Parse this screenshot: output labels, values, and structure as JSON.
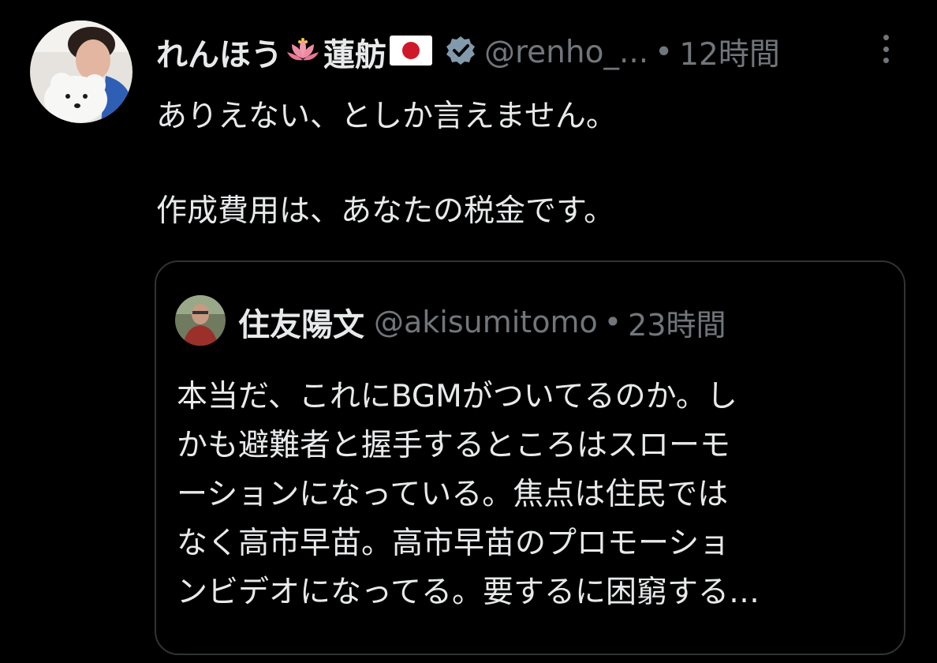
{
  "tweet": {
    "display_name_part1": "れんほう",
    "display_name_part2": "蓮舫",
    "handle": "@renho_...",
    "separator": "•",
    "time": "12時間",
    "text_line1": "ありえない、としか言えません。",
    "text_line2": "作成費用は、あなたの税金です。",
    "icons": [
      "avatar-photo",
      "lotus-emoji",
      "japan-flag-emoji",
      "verified-badge-icon",
      "more-options-icon"
    ]
  },
  "quote": {
    "display_name": "住友陽文",
    "handle": "@akisumitomo",
    "separator": "•",
    "time": "23時間",
    "lines": [
      "本当だ、これにBGMがついてるのか。し",
      "かも避難者と握手するところはスローモ",
      "ーションになっている。焦点は住民では",
      "なく高市早苗。高市早苗のプロモーショ",
      "ンビデオになってる。要するに困窮する…"
    ]
  },
  "colors": {
    "background": "#000000",
    "text_primary": "#e7e9ea",
    "text_secondary": "#71767b",
    "border": "#2f3336",
    "verified_badge": "#829aab"
  }
}
